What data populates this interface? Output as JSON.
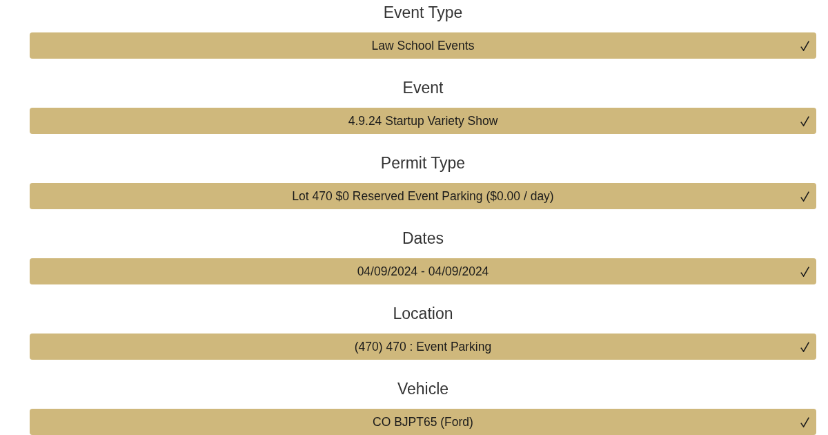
{
  "steps": [
    {
      "heading": "Event Type",
      "value": "Law School Events",
      "checked": true
    },
    {
      "heading": "Event",
      "value": "4.9.24 Startup Variety Show",
      "checked": true
    },
    {
      "heading": "Permit Type",
      "value": "Lot 470 $0 Reserved Event Parking ($0.00 / day)",
      "checked": true
    },
    {
      "heading": "Dates",
      "value": "04/09/2024 - 04/09/2024",
      "checked": true
    },
    {
      "heading": "Location",
      "value": "(470) 470 : Event Parking",
      "checked": true
    },
    {
      "heading": "Vehicle",
      "value": "CO BJPT65 (Ford)",
      "checked": true
    }
  ]
}
